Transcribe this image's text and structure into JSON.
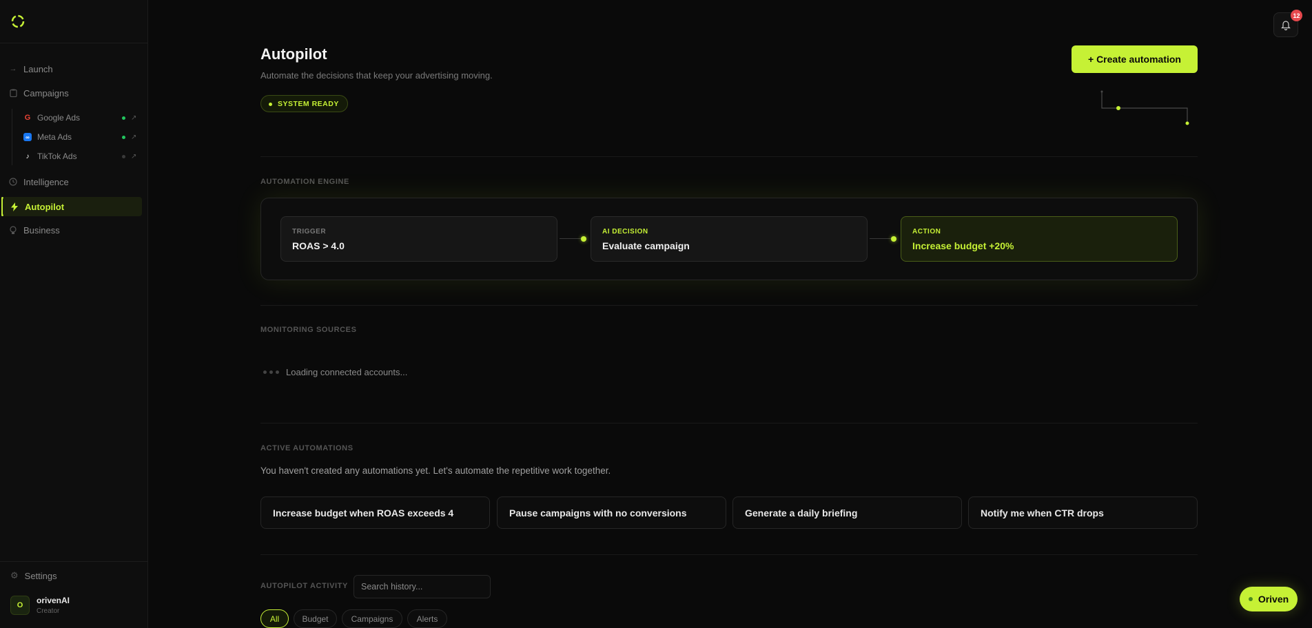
{
  "sidebar": {
    "nav": [
      {
        "label": "Launch",
        "icon": "arrow-right-icon"
      },
      {
        "label": "Campaigns",
        "icon": "clipboard-icon"
      },
      {
        "label": "Intelligence",
        "icon": "clock-icon"
      },
      {
        "label": "Autopilot",
        "icon": "bolt-icon"
      },
      {
        "label": "Business",
        "icon": "bulb-icon"
      }
    ],
    "campaigns": [
      {
        "label": "Google Ads",
        "status_color": "#22c55e"
      },
      {
        "label": "Meta Ads",
        "status_color": "#22c55e"
      },
      {
        "label": "TikTok Ads",
        "status_color": "#3a3a3a"
      }
    ],
    "settings_label": "Settings",
    "user": {
      "initial": "O",
      "name": "orivenAI",
      "role": "Creator"
    }
  },
  "header": {
    "title": "Autopilot",
    "subtitle": "Automate the decisions that keep your advertising moving.",
    "status": "SYSTEM READY",
    "create_label": "+ Create automation",
    "notification_count": "12"
  },
  "engine": {
    "section_label": "AUTOMATION ENGINE",
    "steps": [
      {
        "label": "TRIGGER",
        "value": "ROAS > 4.0"
      },
      {
        "label": "AI DECISION",
        "value": "Evaluate campaign"
      },
      {
        "label": "ACTION",
        "value": "Increase budget +20%"
      }
    ]
  },
  "monitoring": {
    "section_label": "MONITORING SOURCES",
    "loading_text": "Loading connected accounts..."
  },
  "automations": {
    "section_label": "ACTIVE AUTOMATIONS",
    "empty_text": "You haven't created any automations yet. Let's automate the repetitive work together.",
    "suggestions": [
      "Increase budget when ROAS exceeds 4",
      "Pause campaigns with no conversions",
      "Generate a daily briefing",
      "Notify me when CTR drops"
    ]
  },
  "activity": {
    "section_label": "AUTOPILOT ACTIVITY",
    "search_placeholder": "Search history...",
    "filters": [
      "All",
      "Budget",
      "Campaigns",
      "Alerts"
    ]
  },
  "assistant_button": "Oriven",
  "colors": {
    "accent": "#c6f135",
    "background": "#0a0a0a",
    "badge": "#e5484d"
  }
}
